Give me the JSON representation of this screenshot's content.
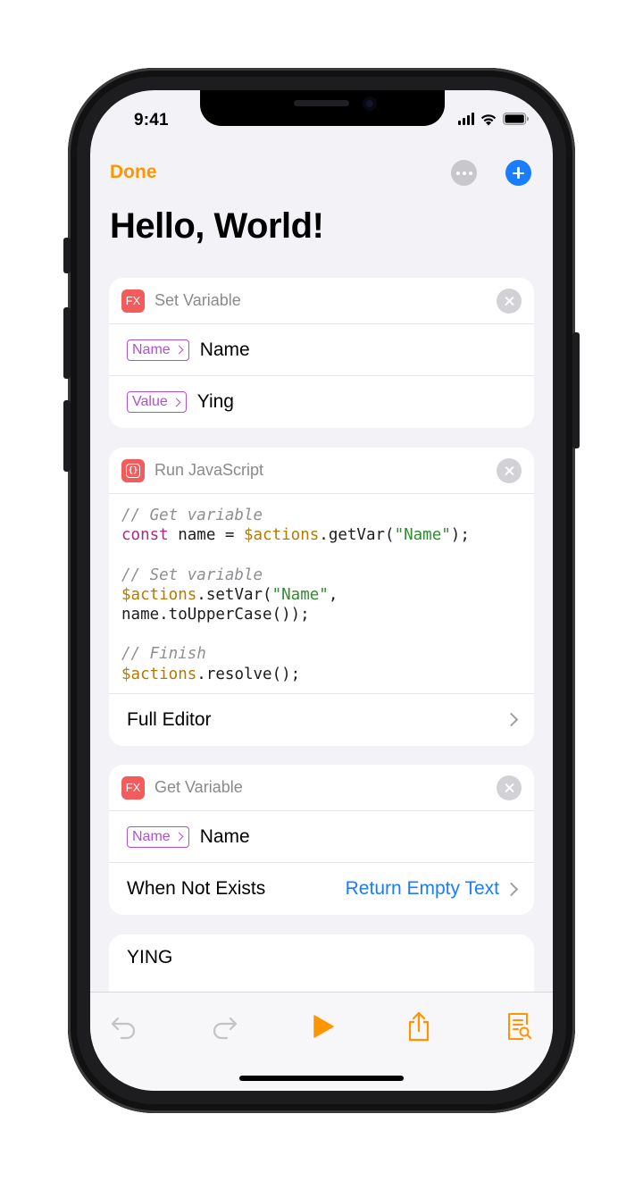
{
  "status_bar": {
    "time": "9:41"
  },
  "nav": {
    "done_label": "Done",
    "title": "Hello, World!"
  },
  "actions": [
    {
      "icon_label": "FX",
      "title": "Set Variable",
      "rows": [
        {
          "tag": "Name",
          "value": "Name"
        },
        {
          "tag": "Value",
          "value": "Ying"
        }
      ]
    },
    {
      "title": "Run JavaScript",
      "icon_label": "{}",
      "code": {
        "comment_get": "// Get variable",
        "kw_const": "const",
        "line2_mid": " name = ",
        "actions_var": "$actions",
        "get_call_open": ".getVar(",
        "str_name": "\"Name\"",
        "call_close_semicolon": ");",
        "comment_set": "// Set variable",
        "set_call_open": ".setVar(",
        "comma": ",",
        "line5": "name.toUpperCase());",
        "comment_finish": "// Finish",
        "resolve_call": ".resolve();"
      },
      "full_editor_label": "Full Editor"
    },
    {
      "icon_label": "FX",
      "title": "Get Variable",
      "rows": [
        {
          "tag": "Name",
          "value": "Name"
        }
      ],
      "when_not_exists_label": "When Not Exists",
      "when_not_exists_value": "Return Empty Text"
    }
  ],
  "output": {
    "text": "YING"
  },
  "colors": {
    "accent": "#ff9500",
    "link": "#1a7cff",
    "tag": "#b14fd8",
    "action_icon": "#f25c5c"
  },
  "toolbar": {
    "icons": [
      "undo-icon",
      "redo-icon",
      "play-icon",
      "share-icon",
      "log-viewer-icon"
    ]
  }
}
